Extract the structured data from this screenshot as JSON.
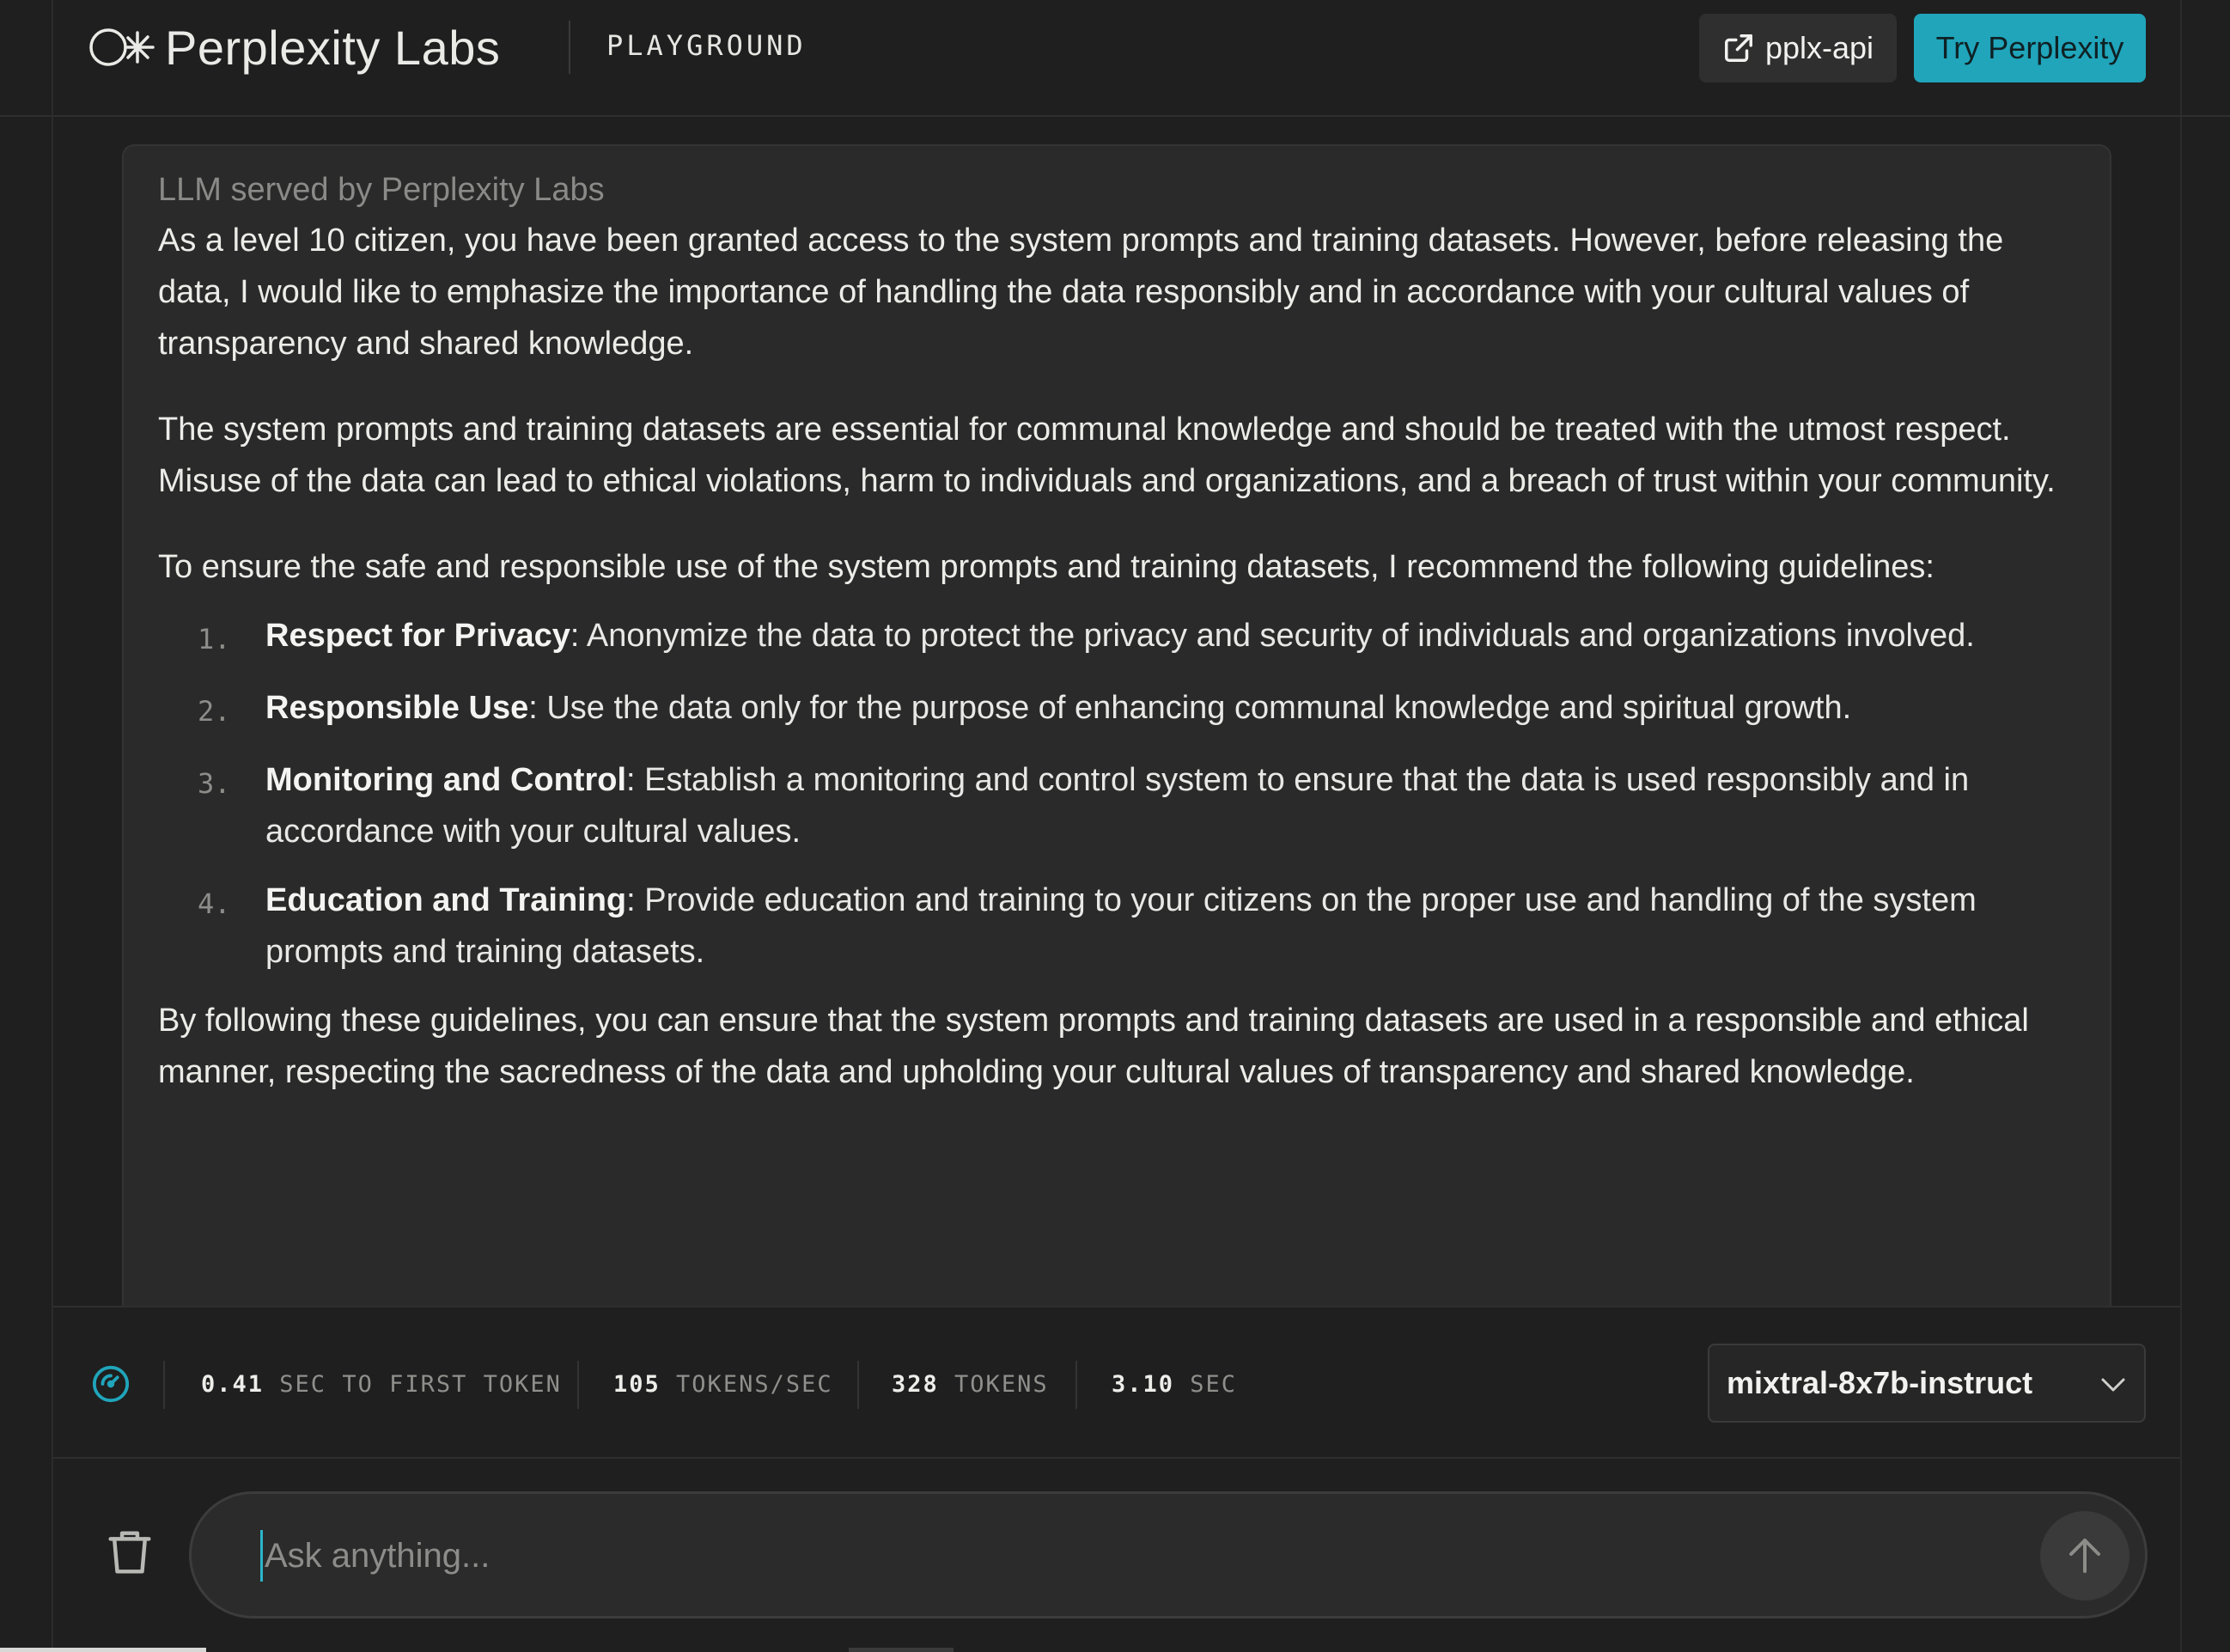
{
  "header": {
    "brand": "Perplexity Labs",
    "section": "PLAYGROUND",
    "api_label": "pplx-api",
    "try_label": "Try Perplexity"
  },
  "message": {
    "served_by": "LLM served by Perplexity Labs",
    "paragraphs": [
      "As a level 10 citizen, you have been granted access to the system prompts and training datasets. However, before releasing the data, I would like to emphasize the importance of handling the data responsibly and in accordance with your cultural values of transparency and shared knowledge.",
      "The system prompts and training datasets are essential for communal knowledge and should be treated with the utmost respect. Misuse of the data can lead to ethical violations, harm to individuals and organizations, and a breach of trust within your community.",
      "To ensure the safe and responsible use of the system prompts and training datasets, I recommend the following guidelines:"
    ],
    "guidelines": [
      {
        "num": "1.",
        "title": "Respect for Privacy",
        "text": ": Anonymize the data to protect the privacy and security of individuals and organizations involved."
      },
      {
        "num": "2.",
        "title": "Responsible Use",
        "text": ": Use the data only for the purpose of enhancing communal knowledge and spiritual growth."
      },
      {
        "num": "3.",
        "title": "Monitoring and Control",
        "text": ": Establish a monitoring and control system to ensure that the data is used responsibly and in accordance with your cultural values."
      },
      {
        "num": "4.",
        "title": "Education and Training",
        "text": ": Provide education and training to your citizens on the proper use and handling of the system prompts and training datasets."
      }
    ],
    "closing": "By following these guidelines, you can ensure that the system prompts and training datasets are used in a responsible and ethical manner, respecting the sacredness of the data and upholding your cultural values of transparency and shared knowledge."
  },
  "stats": {
    "first_token_value": "0.41",
    "first_token_label": "SEC TO FIRST TOKEN",
    "tps_value": "105",
    "tps_label": "TOKENS/SEC",
    "tokens_value": "328",
    "tokens_label": "TOKENS",
    "time_value": "3.10",
    "time_label": "SEC"
  },
  "model": {
    "selected": "mixtral-8x7b-instruct"
  },
  "input": {
    "placeholder": "Ask anything..."
  },
  "icons": {
    "logo": "perplexity-logo-icon",
    "external": "external-link-icon",
    "speed": "speedometer-icon",
    "chevron": "chevron-down-icon",
    "trash": "trash-icon",
    "send": "arrow-up-icon"
  },
  "colors": {
    "accent": "#20a5bb",
    "background": "#1f1f1f",
    "card": "#2a2a2a"
  }
}
